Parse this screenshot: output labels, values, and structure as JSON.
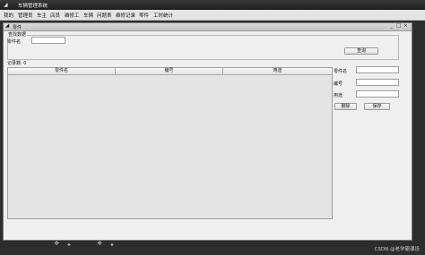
{
  "app": {
    "title": "车辆管理系统",
    "icon": "app-icon"
  },
  "menu": [
    "我的",
    "管理员",
    "车主",
    "店员",
    "维修工",
    "车辆",
    "问题表",
    "维修记录",
    "零件",
    "工时统计"
  ],
  "window": {
    "title": "零件",
    "controls": [
      "_",
      "□",
      "×"
    ]
  },
  "search": {
    "legend": "查找数据",
    "part_name_label": "零件名",
    "part_name_value": "",
    "query_button": "查询"
  },
  "record_count": "记录数: 0",
  "table": {
    "columns": [
      "零件名",
      "编号",
      "用途"
    ],
    "rows": []
  },
  "form": {
    "part_name_label": "零件名",
    "number_label": "编号",
    "usage_label": "用途",
    "part_name_value": "",
    "number_value": "",
    "usage_value": "",
    "delete_button": "删除",
    "save_button": "保存"
  },
  "watermark": "CSDN @老学霸课设"
}
